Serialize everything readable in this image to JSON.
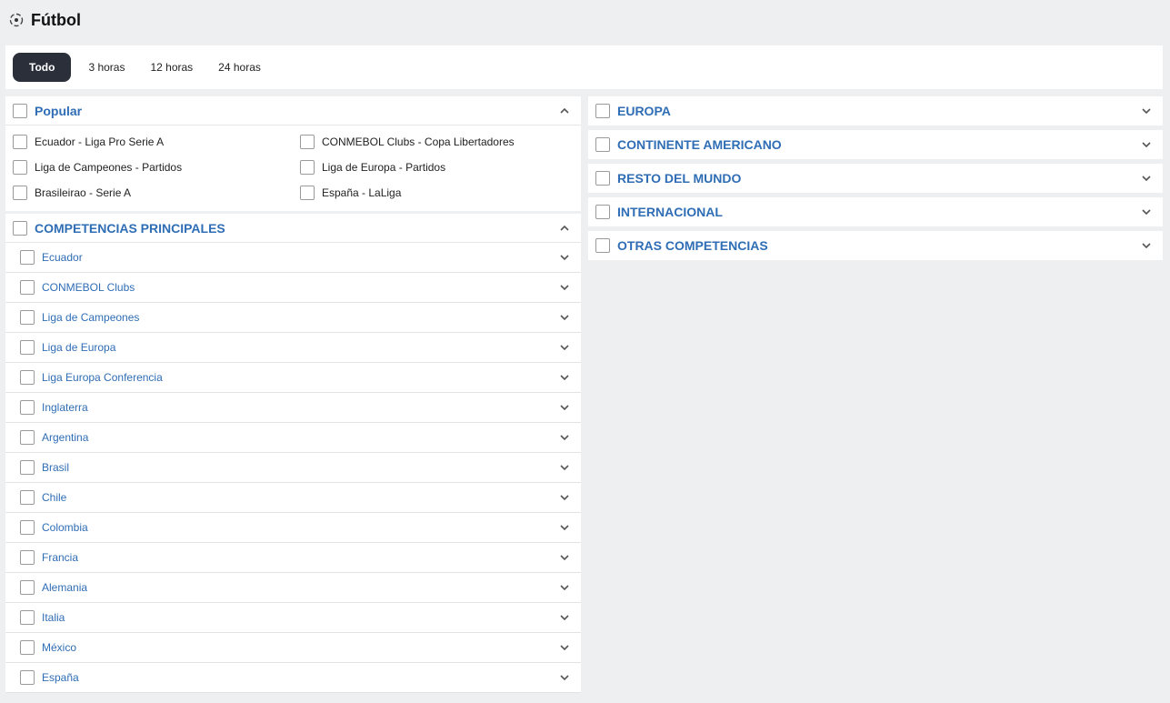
{
  "header": {
    "title": "Fútbol",
    "icon": "soccer-ball-icon"
  },
  "time_filters": [
    {
      "label": "Todo",
      "active": true
    },
    {
      "label": "3 horas",
      "active": false
    },
    {
      "label": "12 horas",
      "active": false
    },
    {
      "label": "24 horas",
      "active": false
    }
  ],
  "popular": {
    "title": "Popular",
    "items": [
      "Ecuador - Liga Pro Serie A",
      "CONMEBOL Clubs - Copa Libertadores",
      "Liga de Campeones - Partidos",
      "Liga de Europa - Partidos",
      "Brasileirao - Serie A",
      "España - LaLiga"
    ]
  },
  "principales": {
    "title": "COMPETENCIAS PRINCIPALES",
    "items": [
      "Ecuador",
      "CONMEBOL Clubs",
      "Liga de Campeones",
      "Liga de Europa",
      "Liga Europa Conferencia",
      "Inglaterra",
      "Argentina",
      "Brasil",
      "Chile",
      "Colombia",
      "Francia",
      "Alemania",
      "Italia",
      "México",
      "España"
    ]
  },
  "regions": [
    "EUROPA",
    "CONTINENTE AMERICANO",
    "RESTO DEL MUNDO",
    "INTERNACIONAL",
    "OTRAS COMPETENCIAS"
  ],
  "colors": {
    "accent": "#2f6db5",
    "active_button": "#2b2f3a",
    "background": "#eeeff1"
  }
}
